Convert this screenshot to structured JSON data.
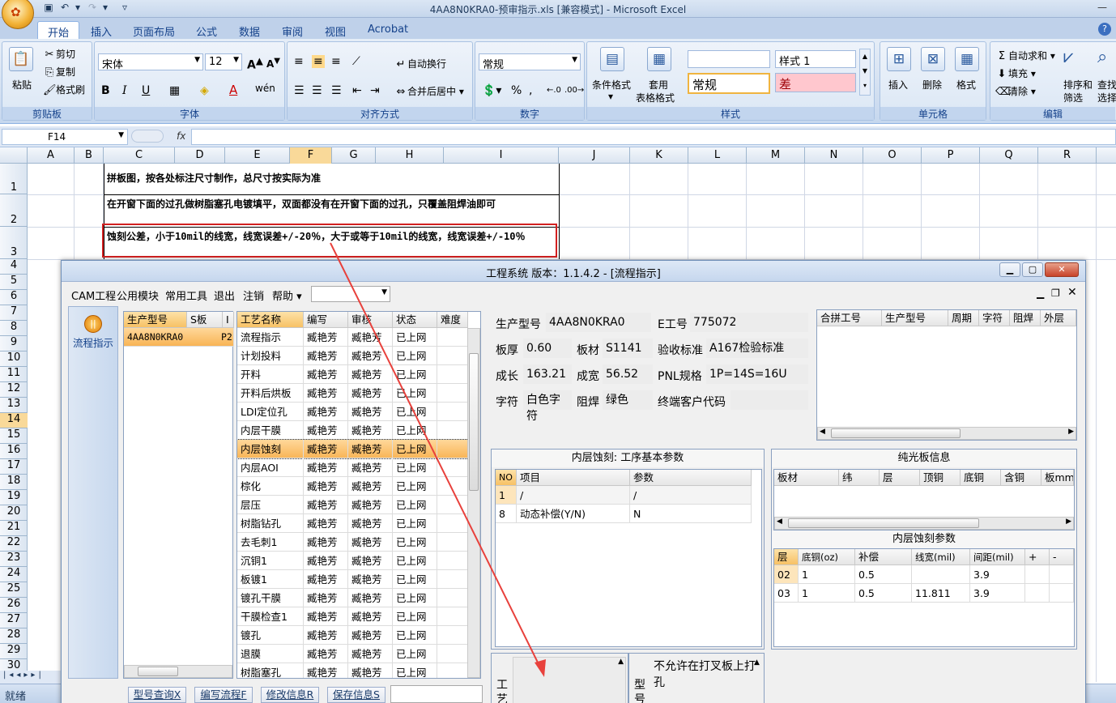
{
  "app": {
    "title": "4AA8N0KRA0-预审指示.xls  [兼容模式] - Microsoft Excel"
  },
  "ribbon": {
    "tabs": [
      "开始",
      "插入",
      "页面布局",
      "公式",
      "数据",
      "审阅",
      "视图",
      "Acrobat"
    ],
    "clipboard": {
      "paste": "粘贴",
      "cut": "剪切",
      "copy": "复制",
      "format_painter": "格式刷",
      "label": "剪贴板"
    },
    "font": {
      "name": "宋体",
      "size": "12",
      "label": "字体",
      "bold": "B",
      "italic": "I",
      "underline": "U",
      "grow": "A",
      "shrink": "A",
      "wen": "wén"
    },
    "alignment": {
      "wrap": "自动换行",
      "merge": "合并后居中",
      "label": "对齐方式"
    },
    "number": {
      "format": "常规",
      "label": "数字",
      "percent": "%",
      "comma": ","
    },
    "styles": {
      "conditional": "条件格式",
      "table_line1": "套用",
      "table_line2": "表格格式",
      "label": "样式",
      "style1": "样式 1",
      "normal": "常规",
      "bad": "差"
    },
    "cells": {
      "insert": "插入",
      "delete": "删除",
      "format": "格式",
      "label": "单元格"
    },
    "editing": {
      "autosum": "自动求和",
      "fill": "填充",
      "clear": "清除",
      "sort_line1": "排序和",
      "sort_line2": "筛选",
      "find_line1": "查找",
      "find_line2": "选择",
      "label": "编辑"
    }
  },
  "formula_bar": {
    "name_box": "F14",
    "fx": "fx",
    "value": ""
  },
  "sheet": {
    "columns": [
      "A",
      "B",
      "C",
      "D",
      "E",
      "F",
      "G",
      "H",
      "I",
      "J",
      "K",
      "L",
      "M",
      "N",
      "O",
      "P",
      "Q",
      "R"
    ],
    "rows": [
      "1",
      "2",
      "3",
      "4",
      "5",
      "6",
      "7",
      "8",
      "9",
      "10",
      "11",
      "12",
      "13",
      "14",
      "15",
      "16",
      "17",
      "18",
      "19",
      "20",
      "21",
      "22",
      "23",
      "24",
      "25",
      "26",
      "27",
      "28",
      "29",
      "30"
    ],
    "row1": "拼板图，按各处标注尺寸制作，总尺寸按实际为准",
    "row2": "在开窗下面的过孔做树脂塞孔电镀填平，双面都没有在开窗下面的过孔，只覆盖阻焊油即可",
    "row3": "蚀刻公差，小于10mil的线宽，线宽误差+/-20％，大于或等于10mil的线宽，线宽误差+/-10％"
  },
  "status": {
    "ready": "就绪"
  },
  "dialog": {
    "title": "工程系统   版本：1.1.4.2 - [流程指示]",
    "menu": [
      "CAM工程",
      "公用模块",
      "常用工具",
      "退出",
      "注销",
      "帮助"
    ],
    "left_button": "流程指示",
    "product_list": {
      "headers": [
        "生产型号",
        "S板",
        "I"
      ],
      "rows": [
        [
          "4AA8N0KRA0",
          "",
          "P2"
        ]
      ]
    },
    "process_list": {
      "headers": [
        "工艺名称",
        "编写",
        "审核",
        "状态",
        "难度"
      ],
      "rows": [
        [
          "流程指示",
          "臧艳芳",
          "臧艳芳",
          "已上网"
        ],
        [
          "计划投料",
          "臧艳芳",
          "臧艳芳",
          "已上网"
        ],
        [
          "开料",
          "臧艳芳",
          "臧艳芳",
          "已上网"
        ],
        [
          "开料后烘板",
          "臧艳芳",
          "臧艳芳",
          "已上网"
        ],
        [
          "LDI定位孔",
          "臧艳芳",
          "臧艳芳",
          "已上网"
        ],
        [
          "内层干膜",
          "臧艳芳",
          "臧艳芳",
          "已上网"
        ],
        [
          "内层蚀刻",
          "臧艳芳",
          "臧艳芳",
          "已上网"
        ],
        [
          "内层AOI",
          "臧艳芳",
          "臧艳芳",
          "已上网"
        ],
        [
          "棕化",
          "臧艳芳",
          "臧艳芳",
          "已上网"
        ],
        [
          "层压",
          "臧艳芳",
          "臧艳芳",
          "已上网"
        ],
        [
          "树脂钻孔",
          "臧艳芳",
          "臧艳芳",
          "已上网"
        ],
        [
          "去毛刺1",
          "臧艳芳",
          "臧艳芳",
          "已上网"
        ],
        [
          "沉铜1",
          "臧艳芳",
          "臧艳芳",
          "已上网"
        ],
        [
          "板镀1",
          "臧艳芳",
          "臧艳芳",
          "已上网"
        ],
        [
          "镀孔干膜",
          "臧艳芳",
          "臧艳芳",
          "已上网"
        ],
        [
          "干膜检查1",
          "臧艳芳",
          "臧艳芳",
          "已上网"
        ],
        [
          "镀孔",
          "臧艳芳",
          "臧艳芳",
          "已上网"
        ],
        [
          "退膜",
          "臧艳芳",
          "臧艳芳",
          "已上网"
        ],
        [
          "树脂塞孔",
          "臧艳芳",
          "臧艳芳",
          "已上网"
        ]
      ]
    },
    "info": {
      "model_label": "生产型号",
      "model": "4AA8N0KRA0",
      "e_label": "E工号",
      "e": "775072",
      "thickness_label": "板厚",
      "thickness": "0.60",
      "material_label": "板材",
      "material": "S1141",
      "standard_label": "验收标准",
      "standard": "A167检验标准",
      "length_label": "成长",
      "length": "163.21",
      "width_label": "成宽",
      "width": "56.52",
      "pnl_label": "PNL规格",
      "pnl": "1P=14S=16U",
      "char_label": "字符",
      "char": "白色字符",
      "mask_label": "阻焊",
      "mask": "绿色",
      "customer_label": "终端客户代码",
      "customer": ""
    },
    "combine_table": {
      "headers": [
        "合拼工号",
        "生产型号",
        "周期",
        "字符",
        "阻焊",
        "外层"
      ]
    },
    "etch_params": {
      "title": "内层蚀刻: 工序基本参数",
      "headers": [
        "NO",
        "项目",
        "参数"
      ],
      "rows": [
        [
          "1",
          "/",
          "/"
        ],
        [
          "8",
          "动态补偿(Y/N)",
          "N"
        ]
      ]
    },
    "bare_board": {
      "title": "纯光板信息",
      "headers": [
        "板材",
        "纬",
        "层",
        "顶铜",
        "底铜",
        "含铜",
        "板mm"
      ]
    },
    "inner_etch": {
      "title": "内层蚀刻参数",
      "headers": [
        "层",
        "底铜(oz)",
        "补偿",
        "线宽(mil)",
        "间距(mil)",
        "+",
        "-"
      ],
      "rows": [
        [
          "02",
          "1",
          "0.5",
          "",
          "3.9",
          "",
          ""
        ],
        [
          "03",
          "1",
          "0.5",
          "11.811",
          "3.9",
          "",
          ""
        ]
      ]
    },
    "note_left": "工艺",
    "note_right_label": "型号",
    "note_right": "不允许在打叉板上打孔",
    "bottom_buttons": [
      "型号查询X",
      "编写流程F",
      "修改信息R",
      "保存信息S"
    ]
  },
  "colors": {
    "arrow": "#e8413c",
    "highlight": "#ffc66b",
    "box_red": "#d21f1f"
  }
}
